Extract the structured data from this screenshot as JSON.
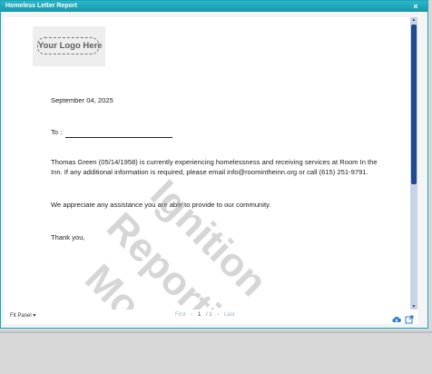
{
  "window": {
    "title": "Homeless Letter Report",
    "close_glyph": "×"
  },
  "logo": {
    "text": "Your Logo Here"
  },
  "letter": {
    "date": "September 04, 2025",
    "to_label": "To :",
    "body1": "Thomas  Green (05/14/1958) is currently experiencing homelessness and receiving services at Room In the Inn. If any additional information is required, please email info@roomintheinn.org or call (615) 251-9791.",
    "body2": "We appreciate any assistance you are able to provide to our community.",
    "closing": "Thank you,"
  },
  "watermark": {
    "line1": "Ignition",
    "line2": "Reporting",
    "line3": "Mode"
  },
  "toolbar": {
    "fit_panel_label": "Fit Panel",
    "fit_panel_caret": "▾",
    "first_label": "First",
    "prev_glyph": "‹",
    "page_current": "1",
    "page_total": "/ 1",
    "next_glyph": "›",
    "last_label": "Last",
    "download_icon": "cloud-download-icon",
    "open_icon": "open-external-icon"
  },
  "colors": {
    "accent": "#1fa9bb",
    "scroll_thumb": "#1f4a8c",
    "icon_blue": "#2b7bd3"
  }
}
